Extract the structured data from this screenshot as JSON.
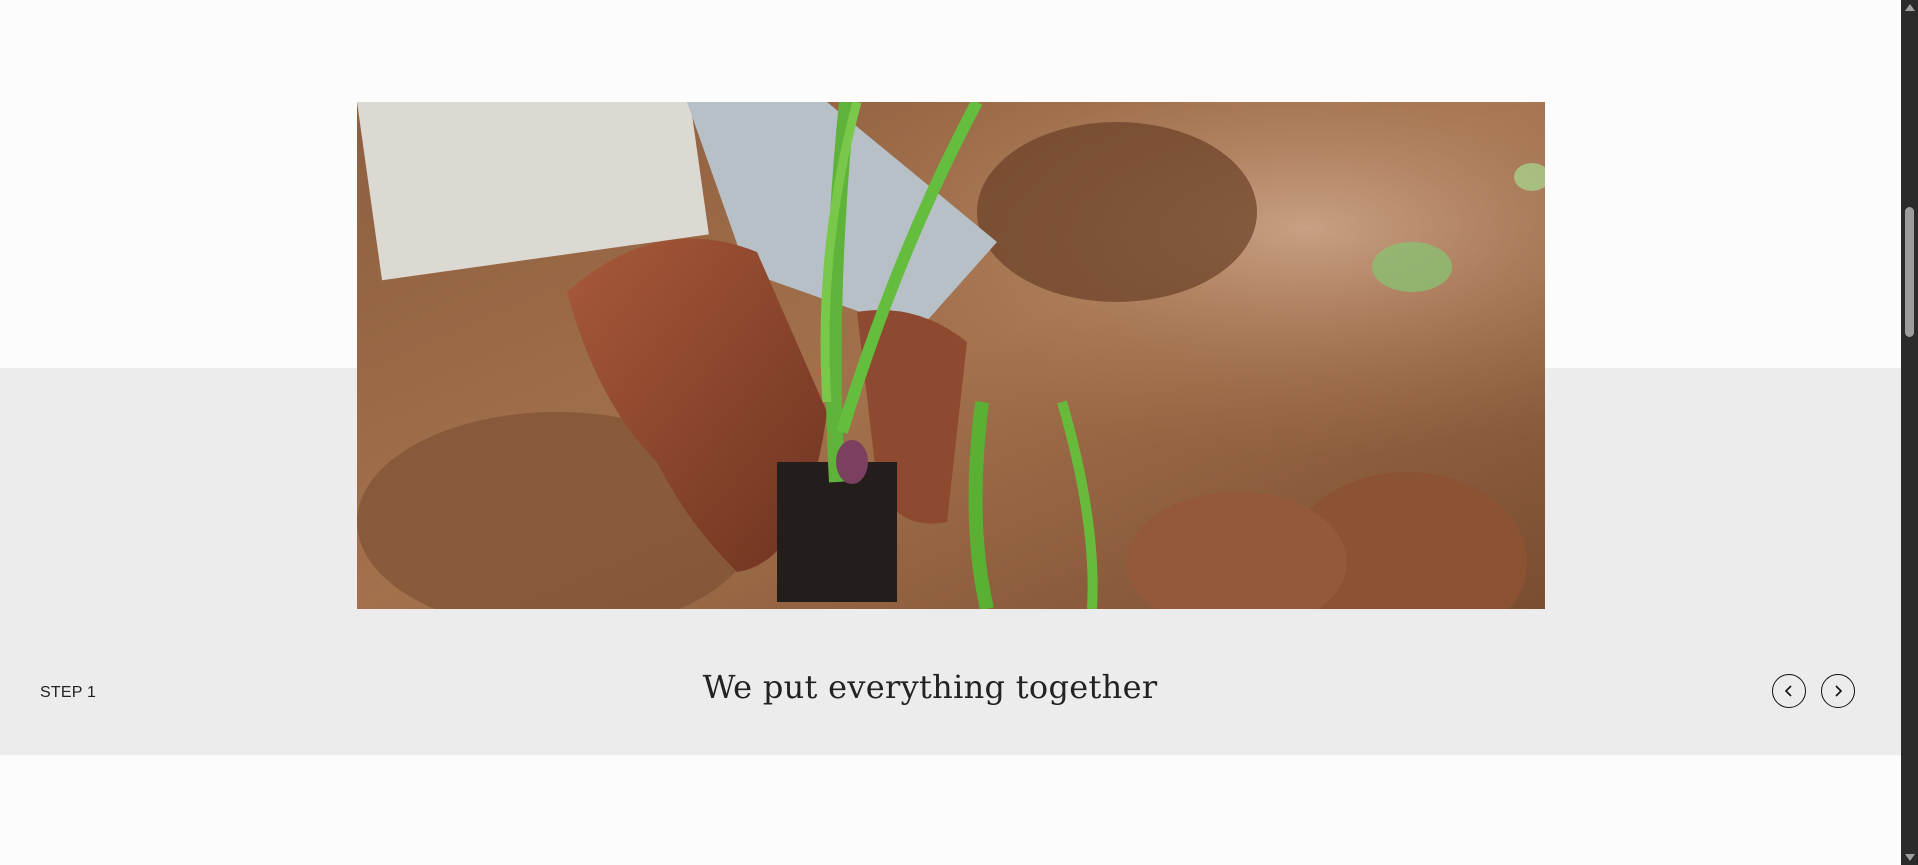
{
  "hero": {
    "image_alt": "Gloved hand planting an onion seedling in soil"
  },
  "step": {
    "label": "STEP 1",
    "title": "We put everything together"
  },
  "carousel": {
    "prev_icon": "chevron-left-icon",
    "next_icon": "chevron-right-icon"
  },
  "colors": {
    "band": "#ececec",
    "background": "#fdfcfc",
    "text": "#222222"
  }
}
